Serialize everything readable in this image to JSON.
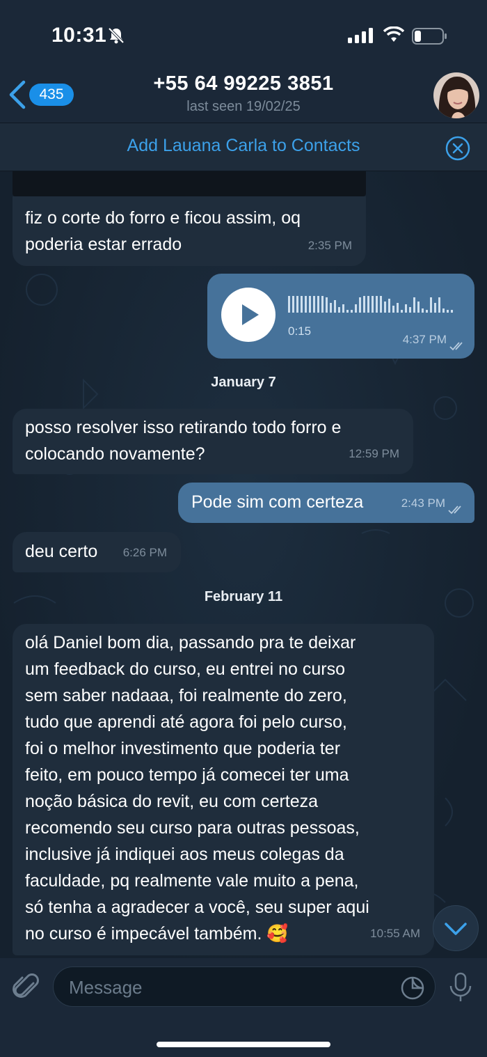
{
  "status_bar": {
    "time": "10:31",
    "bell_icon": "bell-muted-icon",
    "signal_icon": "signal-icon",
    "wifi_icon": "wifi-icon",
    "battery_icon": "battery-icon"
  },
  "header": {
    "back_badge": "435",
    "title": "+55 64 99225 3851",
    "subtitle": "last seen 19/02/25"
  },
  "contact_banner": {
    "label": "Add Lauana Carla to Contacts"
  },
  "messages": [
    {
      "direction": "in",
      "text": "fiz o corte do forro e ficou assim, oq poderia estar errado",
      "lines": [
        "fiz o corte do forro e ficou assim, oq",
        "poderia estar errado"
      ],
      "time": "2:35 PM"
    },
    {
      "direction": "out",
      "type": "voice",
      "duration": "0:15",
      "time": "4:37 PM",
      "status": "read"
    },
    {
      "date": "January 7"
    },
    {
      "direction": "in",
      "text": "posso resolver isso retirando todo forro e colocando novamente?",
      "lines": [
        "posso resolver isso retirando todo forro e",
        "colocando novamente?"
      ],
      "time": "12:59 PM"
    },
    {
      "direction": "out",
      "text": "Pode sim com certeza",
      "time": "2:43 PM",
      "status": "read"
    },
    {
      "direction": "in",
      "text": "deu certo",
      "time": "6:26 PM"
    },
    {
      "date": "February 11"
    },
    {
      "direction": "in",
      "text": "olá Daniel bom dia, passando pra te deixar um feedback do curso, eu entrei no curso sem saber nadaaa, foi realmente do zero, tudo que aprendi até agora foi pelo curso, foi o melhor investimento que poderia ter feito, em pouco tempo já comecei ter uma noção básica do revit, eu com certeza recomendo seu curso para outras pessoas, inclusive já indiquei aos meus colegas da faculdade, pq realmente vale muito a pena, só tenha a agradecer a você, seu super aqui no curso é impecável também. 🥰",
      "lines": [
        "olá Daniel bom dia, passando pra te deixar",
        "um feedback do curso, eu entrei no curso",
        "sem saber nadaaa, foi realmente do zero,",
        "tudo que aprendi até agora foi pelo curso,",
        "foi o melhor investimento que poderia ter",
        "feito, em pouco tempo já comecei ter uma",
        "noção básica do revit, eu com certeza",
        "recomendo seu curso para outras pessoas,",
        "inclusive já indiquei aos meus colegas da",
        "faculdade, pq realmente vale muito a pena,",
        "só tenha a agradecer a você, seu super aqui",
        "no curso é impecável também. 🥰"
      ],
      "time": "10:55 AM"
    }
  ],
  "input": {
    "placeholder": "Message"
  },
  "colors": {
    "accent": "#3ca1ea",
    "outgoing_bubble": "#46729a",
    "incoming_bubble": "#1f2d3c",
    "background": "#16222f"
  }
}
